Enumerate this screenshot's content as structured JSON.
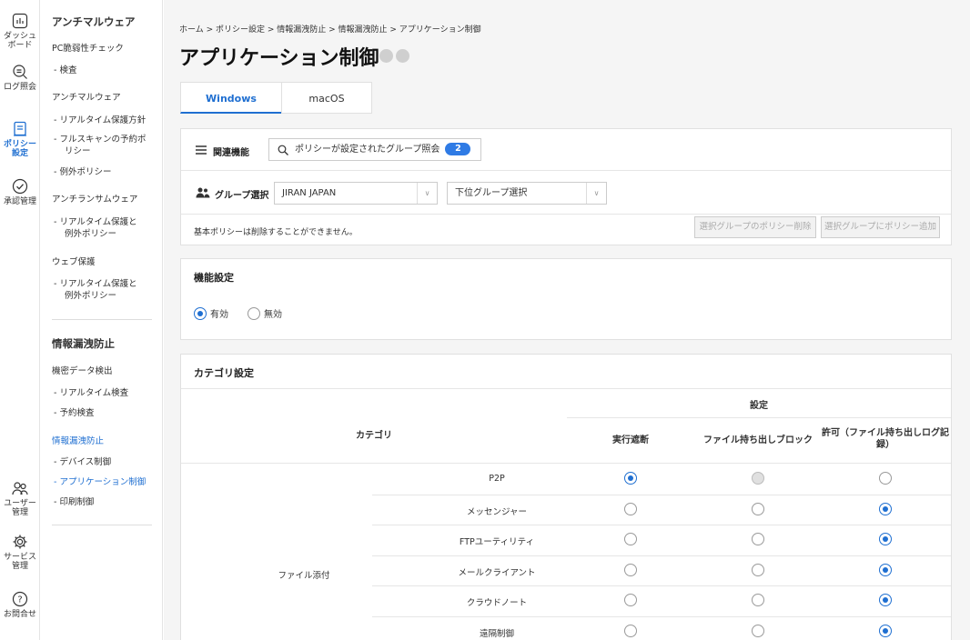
{
  "rail": [
    {
      "label": "ダッシュ\nボード",
      "icon": "dashboard-icon"
    },
    {
      "label": "ログ照会",
      "icon": "log-search-icon"
    },
    {
      "label": "ポリシー\n設定",
      "icon": "policy-icon",
      "active": true
    },
    {
      "label": "承認管理",
      "icon": "approval-icon"
    },
    {
      "label": "ユーザー\n管理",
      "icon": "users-icon"
    },
    {
      "label": "サービス\n管理",
      "icon": "gear-icon"
    },
    {
      "label": "お問合せ",
      "icon": "help-icon"
    }
  ],
  "submenu": {
    "antimalware_title": "アンチマルウェア",
    "pc_vuln": "PC脆弱性チェック",
    "inspect": "- 検査",
    "antimalware_group": "アンチマルウェア",
    "realtime_policy": "- リアルタイム保護方針",
    "fullscan_1": "- フルスキャンの予約ポ",
    "fullscan_2": "リシー",
    "exception_policy": "- 例外ポリシー",
    "antiransom_group": "アンチランサムウェア",
    "ar_realtime_1": "- リアルタイム保護と",
    "ar_realtime_2": "例外ポリシー",
    "web_group": "ウェブ保護",
    "web_realtime_1": "- リアルタイム保護と",
    "web_realtime_2": "例外ポリシー",
    "dlp_title": "情報漏洩防止",
    "confidential_detect": "機密データ検出",
    "realtime_inspect": "- リアルタイム検査",
    "scheduled_inspect": "- 予約検査",
    "dlp_group": "情報漏洩防止",
    "device_control": "- デバイス制御",
    "app_control": "- アプリケーション制御",
    "print_control": "- 印刷制御"
  },
  "breadcrumb": "ホーム > ポリシー設定 > 情報漏洩防止 > 情報漏洩防止 > アプリケーション制御",
  "page_title": "アプリケーション制御",
  "tabs": [
    "Windows",
    "macOS"
  ],
  "related": {
    "label": "関連機能",
    "search_text": "ポリシーが設定されたグループ照会",
    "count": "2"
  },
  "group_select": {
    "label": "グループ選択",
    "value": "JIRAN JAPAN",
    "sub_placeholder": "下位グループ選択"
  },
  "note": "基本ポリシーは削除することができません。",
  "buttons": {
    "delete": "選択グループのポリシー削除",
    "add": "選択グループにポリシー追加"
  },
  "feature": {
    "title": "機能設定",
    "enabled": "有効",
    "disabled": "無効",
    "selected": "enabled"
  },
  "category": {
    "title": "カテゴリ設定",
    "col_category": "カテゴリ",
    "col_setting": "設定",
    "col_block": "実行遮断",
    "col_file_block": "ファイル持ち出しブロック",
    "col_allow": "許可（ファイル持ち出しログ記録）",
    "group": "ファイル添付",
    "rows": [
      {
        "name": "P2P",
        "state": [
          1,
          2,
          0
        ]
      },
      {
        "name": "メッセンジャー",
        "state": [
          0,
          0,
          1
        ]
      },
      {
        "name": "FTPユーティリティ",
        "state": [
          0,
          0,
          1
        ]
      },
      {
        "name": "メールクライアント",
        "state": [
          0,
          0,
          1
        ]
      },
      {
        "name": "クラウドノート",
        "state": [
          0,
          0,
          1
        ]
      },
      {
        "name": "遠隔制御",
        "state": [
          0,
          0,
          1
        ]
      }
    ]
  },
  "colors": {
    "accent": "#1f6fd1",
    "badge": "#2f7be5"
  }
}
